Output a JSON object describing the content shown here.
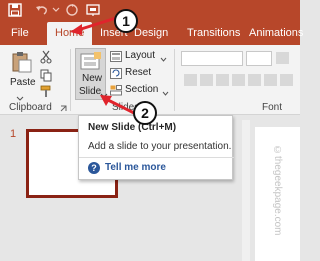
{
  "ribbon_tabs": [
    "File",
    "Home",
    "Insert",
    "Design",
    "Transitions",
    "Animations"
  ],
  "clipboard": {
    "paste_label": "Paste",
    "group_label": "Clipboard"
  },
  "slides_group": {
    "new_slide_line1": "New",
    "new_slide_line2": "Slide",
    "layout_label": "Layout",
    "reset_label": "Reset",
    "section_label": "Section",
    "group_label": "Slides"
  },
  "font_group": {
    "group_label": "Font"
  },
  "tooltip": {
    "title": "New Slide (Ctrl+M)",
    "description": "Add a slide to your presentation.",
    "help_icon": "?",
    "link": "Tell me more"
  },
  "thumbnail": {
    "number": "1"
  },
  "callouts": [
    "1",
    "2"
  ],
  "watermark": "©thegeekpage.com",
  "colors": {
    "accent": "#b7472a",
    "thumb_border": "#8a2214",
    "arrow": "#e0242c",
    "link": "#2b579a"
  }
}
